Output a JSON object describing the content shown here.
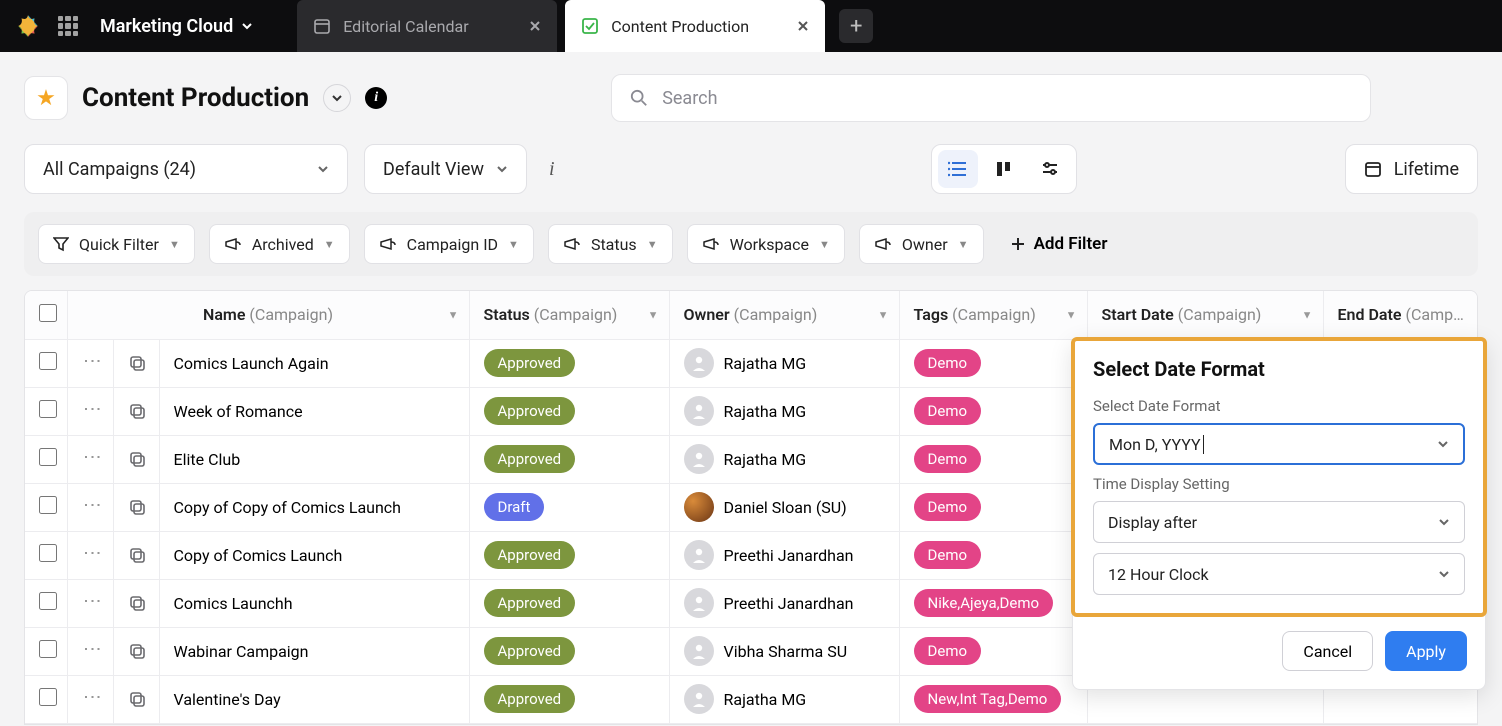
{
  "topbar": {
    "brand": "Marketing Cloud",
    "tabs": [
      {
        "label": "Editorial Calendar",
        "active": false,
        "icon": "calendar-icon"
      },
      {
        "label": "Content Production",
        "active": true,
        "icon": "content-icon"
      }
    ]
  },
  "page": {
    "title": "Content Production",
    "search_placeholder": "Search"
  },
  "controls": {
    "campaigns_dd": "All Campaigns (24)",
    "view_dd": "Default View",
    "lifetime": "Lifetime"
  },
  "filters": {
    "quick": "Quick Filter",
    "archived": "Archived",
    "campaign_id": "Campaign ID",
    "status": "Status",
    "workspace": "Workspace",
    "owner": "Owner",
    "add": "Add Filter"
  },
  "columns": {
    "name": {
      "label": "Name",
      "sub": "(Campaign)"
    },
    "status": {
      "label": "Status",
      "sub": "(Campaign)"
    },
    "owner": {
      "label": "Owner",
      "sub": "(Campaign)"
    },
    "tags": {
      "label": "Tags",
      "sub": "(Campaign)"
    },
    "start": {
      "label": "Start Date",
      "sub": "(Campaign)"
    },
    "end": {
      "label": "End Date",
      "sub": "(Camp…"
    }
  },
  "rows": [
    {
      "name": "Comics Launch Again",
      "status": "Approved",
      "status_kind": "approved",
      "owner": "Rajatha MG",
      "avatar": "blank",
      "tags": "Demo"
    },
    {
      "name": "Week of Romance",
      "status": "Approved",
      "status_kind": "approved",
      "owner": "Rajatha MG",
      "avatar": "blank",
      "tags": "Demo"
    },
    {
      "name": "Elite Club",
      "status": "Approved",
      "status_kind": "approved",
      "owner": "Rajatha MG",
      "avatar": "blank",
      "tags": "Demo"
    },
    {
      "name": "Copy of Copy of Comics Launch",
      "status": "Draft",
      "status_kind": "draft",
      "owner": "Daniel Sloan (SU)",
      "avatar": "img",
      "tags": "Demo"
    },
    {
      "name": "Copy of Comics Launch",
      "status": "Approved",
      "status_kind": "approved",
      "owner": "Preethi Janardhan",
      "avatar": "blank",
      "tags": "Demo"
    },
    {
      "name": "Comics Launchh",
      "status": "Approved",
      "status_kind": "approved",
      "owner": "Preethi Janardhan",
      "avatar": "blank",
      "tags": "Nike,Ajeya,Demo"
    },
    {
      "name": "Wabinar Campaign",
      "status": "Approved",
      "status_kind": "approved",
      "owner": "Vibha Sharma SU",
      "avatar": "blank",
      "tags": "Demo"
    },
    {
      "name": "Valentine's Day",
      "status": "Approved",
      "status_kind": "approved",
      "owner": "Rajatha MG",
      "avatar": "blank",
      "tags": "New,Int Tag,Demo"
    }
  ],
  "modal": {
    "title": "Select Date Format",
    "label_format": "Select Date Format",
    "format_value": "Mon D, YYYY",
    "label_time": "Time Display Setting",
    "time_value": "Display after",
    "clock_value": "12 Hour Clock",
    "cancel": "Cancel",
    "apply": "Apply"
  }
}
